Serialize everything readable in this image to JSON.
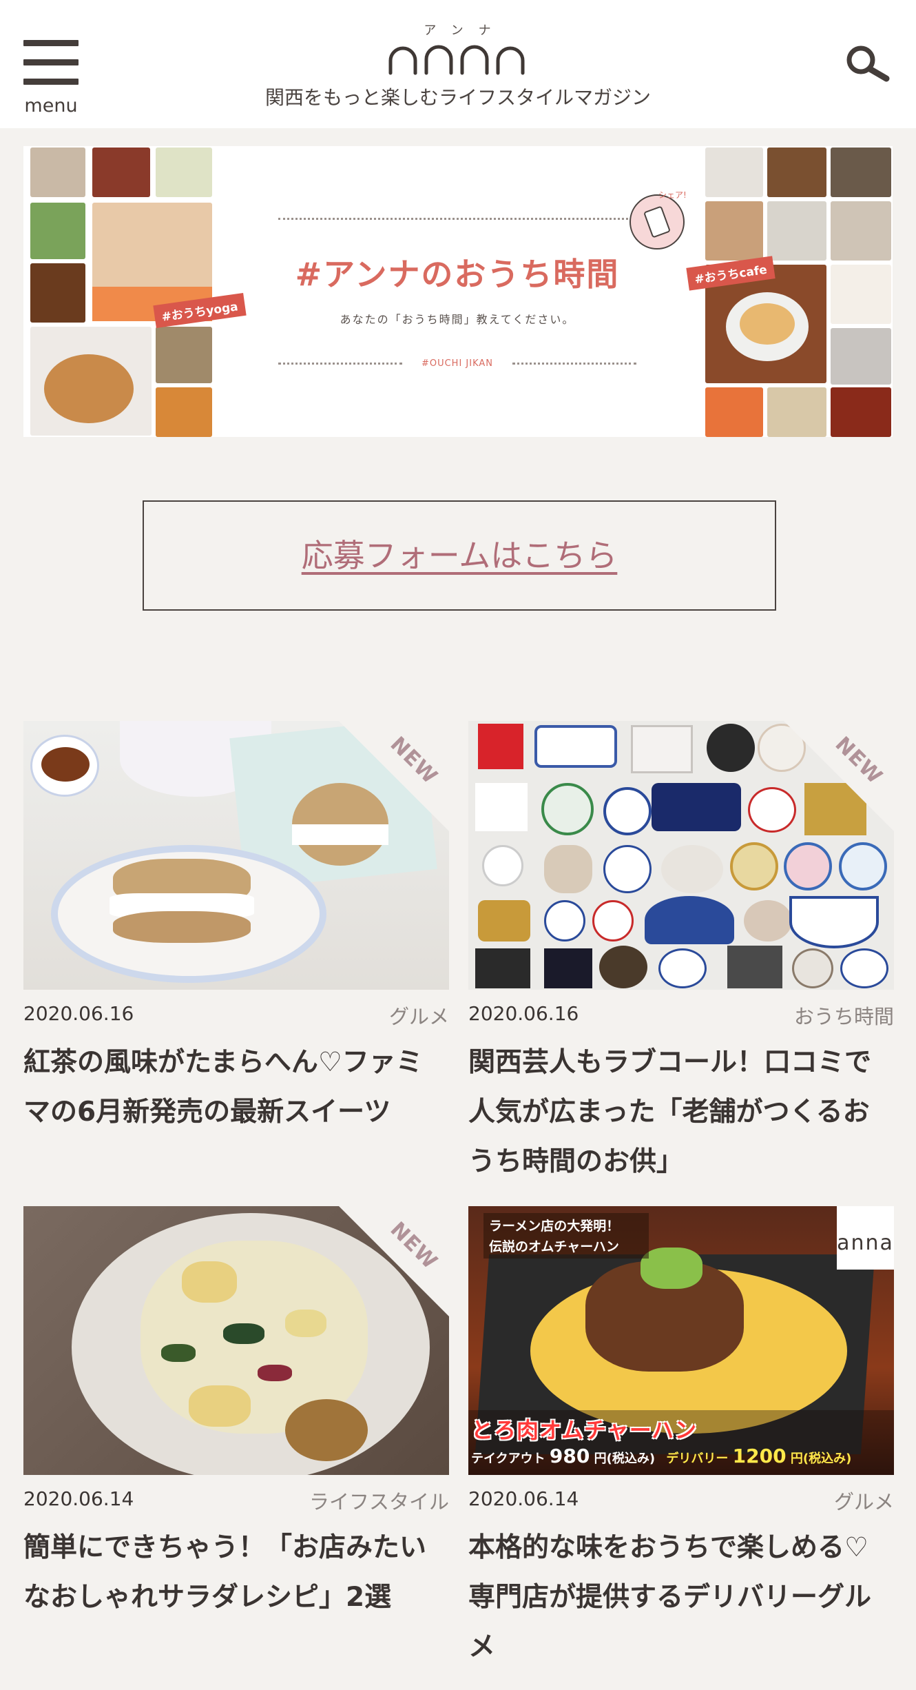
{
  "header": {
    "menu_label": "menu",
    "logo_ruby": "アンナ",
    "logo_text": "anna",
    "tagline": "関西をもっと楽しむライフスタイルマガジン"
  },
  "banner": {
    "title": "#アンナのおうち時間",
    "subtitle": "あなたの「おうち時間」教えてください。",
    "hashtag": "#OUCHI JIKAN",
    "tag_yoga": "#おうちyoga",
    "tag_cafe": "#おうちcafe",
    "share_label": "シェア!"
  },
  "apply_button": "応募フォームはこちら",
  "articles": [
    {
      "date": "2020.06.16",
      "category": "グルメ",
      "title": "紅茶の風味がたまらへん♡ファミマの6月新発売の最新スイーツ",
      "badge": "NEW"
    },
    {
      "date": "2020.06.16",
      "category": "おうち時間",
      "title": "関西芸人もラブコール！口コミで人気が広まった「老舗がつくるおうち時間のお供」",
      "badge": "NEW"
    },
    {
      "date": "2020.06.14",
      "category": "ライフスタイル",
      "title": "簡単にできちゃう！「お店みたいなおしゃれサラダレシピ」2選",
      "badge": "NEW"
    },
    {
      "date": "2020.06.14",
      "category": "グルメ",
      "title": "本格的な味をおうちで楽しめる♡専門店が提供するデリバリーグルメ",
      "badge": ""
    }
  ],
  "article4_overlay": {
    "top_caption_1": "ラーメン店の大発明！",
    "top_caption_2": "伝説のオムチャーハン",
    "dish_name": "とろ肉オムチャーハン",
    "takeout_label": "テイクアウト",
    "takeout_price": "980",
    "delivery_label": "デリバリー",
    "delivery_price": "1200",
    "tax_note": "円(税込み)",
    "corner_logo": "anna"
  }
}
